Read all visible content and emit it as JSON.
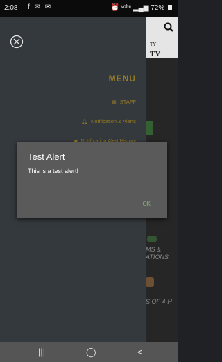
{
  "status_bar": {
    "time": "2:08",
    "left_icons": "f ✉ ✉",
    "right_icons": "⏰ ᵛᵒˡᵗᵉ ▂▄▆",
    "battery": "72%"
  },
  "background_page": {
    "text_line1": "TY",
    "text_line2": "TY",
    "bottom_text": "MS & ATIONS",
    "bottom_text2": "S OF 4-H"
  },
  "drawer": {
    "title": "MENU",
    "items": [
      {
        "icon": "staff-icon",
        "label": "STAFF"
      },
      {
        "icon": "bell-icon",
        "label": "Notification & Alerts"
      },
      {
        "icon": "megaphone-icon",
        "label": "Notification Alert History"
      }
    ]
  },
  "dialog": {
    "title": "Test Alert",
    "message": "This is a test alert!",
    "ok": "OK"
  },
  "navbar": {
    "recents": "|||",
    "home": "◯",
    "back": "<"
  }
}
